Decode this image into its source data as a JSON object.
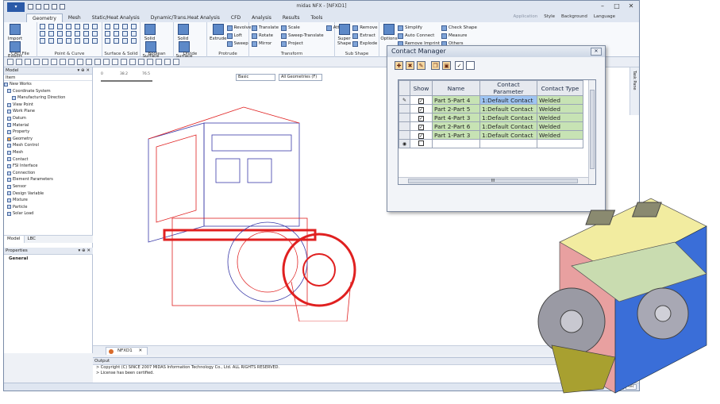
{
  "window": {
    "title": "midas NFX - [NFXD1]"
  },
  "menu_tabs": [
    "Geometry",
    "Mesh",
    "Static/Heat Analysis",
    "Dynamic/Trans.Heat Analysis",
    "CFD",
    "Analysis",
    "Results",
    "Tools"
  ],
  "menu_right": [
    "Application",
    "Style",
    "Background",
    "Language"
  ],
  "ribbon": {
    "cad_file": {
      "label": "CAD File",
      "import": "Import",
      "export": "Export"
    },
    "point_curve": {
      "label": "Point & Curve"
    },
    "surface_solid": {
      "label": "Surface & Solid"
    },
    "boolean": {
      "label": "Boolean",
      "solid": "Solid",
      "surface": "Surface"
    },
    "divide": {
      "label": "Divide",
      "solid": "Solid",
      "surface": "Surface"
    },
    "protrude": {
      "label": "Protrude",
      "extrude": "Extrude",
      "revolve": "Revolve",
      "loft": "Loft",
      "sweep": "Sweep"
    },
    "transform": {
      "label": "Transform",
      "translate": "Translate",
      "rotate": "Rotate",
      "mirror": "Mirror",
      "scale": "Scale",
      "sweep_translate": "Sweep-Translate",
      "project": "Project",
      "attach": "Attach"
    },
    "sub_shape": {
      "label": "Sub Shape",
      "super_shape": "Super Shape",
      "remove": "Remove",
      "extract": "Extract",
      "explode": "Explode"
    },
    "tools": {
      "options": "Options",
      "simplify": "Simplify",
      "auto_connect": "Auto Connect",
      "remove_imprint": "Remove Imprint",
      "check_shape": "Check Shape",
      "measure": "Measure",
      "others": "Others"
    }
  },
  "model_panel": {
    "title": "Model",
    "column": "Item",
    "items": [
      "New Works",
      "Coordinate System",
      "Manufacturing Direction",
      "View Point",
      "Work Plane",
      "Datum",
      "Material",
      "Property",
      "Geometry",
      "Mesh Control",
      "Mesh",
      "Contact",
      "FSI Interface",
      "Connection",
      "Element Parameters",
      "Sensor",
      "Design Variable",
      "Mixture",
      "Particle",
      "Solar Load"
    ],
    "tabs": [
      "Model",
      "LBC"
    ]
  },
  "properties_panel": {
    "title": "Properties",
    "section": "General"
  },
  "viewport": {
    "ruler": [
      "0",
      "38.2",
      "76.5"
    ],
    "display_mode": "Basic",
    "filter": "All Geometries (F)",
    "zoom": "15"
  },
  "doc_tab": "NFXD1",
  "output": {
    "title": "Output",
    "lines": [
      "> Copyright (C) SINCE 2007 MIDAS Information Technology Co., Ltd. ALL RIGHTS RESERVED.",
      "> License has been certified."
    ]
  },
  "right_tab": "Task Pane",
  "status": {
    "unit": "N",
    "time_unit": "sec"
  },
  "contact_manager": {
    "title": "Contact Manager",
    "columns": [
      "Show",
      "Name",
      "Contact Parameter",
      "Contact Type"
    ],
    "rows": [
      {
        "name": "Part 5-Part 4",
        "parameter": "1:Default Contact",
        "type": "Welded"
      },
      {
        "name": "Part 2-Part 5",
        "parameter": "1:Default Contact",
        "type": "Welded"
      },
      {
        "name": "Part 4-Part 3",
        "parameter": "1:Default Contact",
        "type": "Welded"
      },
      {
        "name": "Part 2-Part 6",
        "parameter": "1:Default Contact",
        "type": "Welded"
      },
      {
        "name": "Part 1-Part 3",
        "parameter": "1:Default Contact",
        "type": "Welded"
      }
    ],
    "scroll_label": "III"
  },
  "colors": {
    "ribbon_blue": "#5d89c8",
    "row_green": "#c7e3b4",
    "row_selected": "#9ec4f2",
    "wire_red": "#e02020",
    "wire_blue": "#3a3aa8",
    "part_yellow": "#f2eca0",
    "part_pink": "#e8a0a0",
    "part_green": "#c9dcb0",
    "part_blue": "#3a6ed8",
    "part_olive": "#a8a030"
  }
}
